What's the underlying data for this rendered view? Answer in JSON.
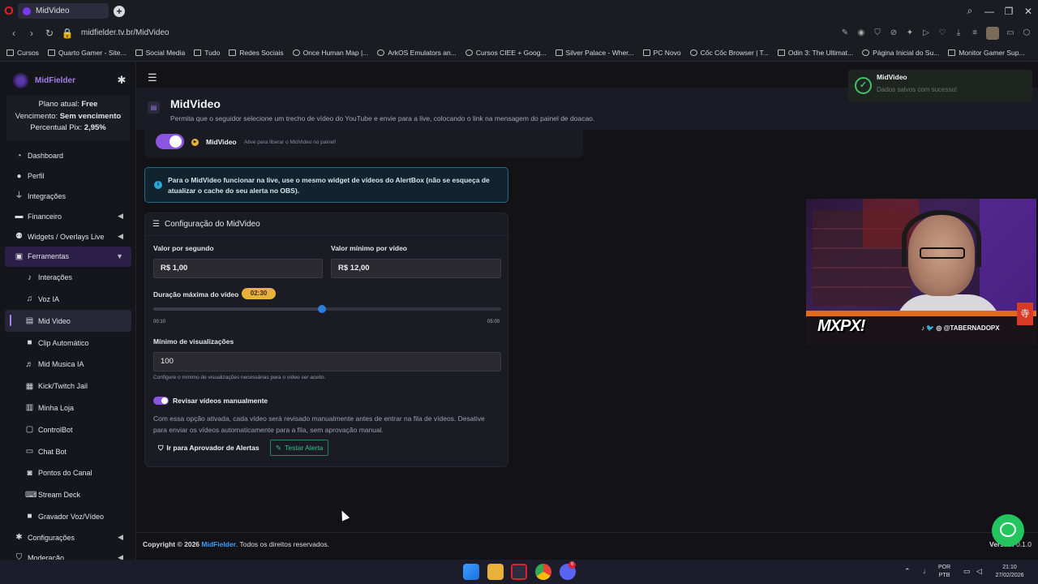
{
  "browser": {
    "tab_title": "MidVideo",
    "url": "midfielder.tv.br/MidVideo",
    "bookmarks": [
      "Cursos",
      "Quarto Gamer - Site...",
      "Social Media",
      "Tudo",
      "Redes Sociais",
      "Once Human Map |...",
      "ArkOS Emulators an...",
      "Cursos CIEE + Goog...",
      "Silver Palace - Wher...",
      "PC Novo",
      "Cốc Cốc Browser | T...",
      "Odin 3: The Ultimat...",
      "Página Inicial do Su...",
      "Monitor Gamer Sup..."
    ]
  },
  "sidebar": {
    "brand": "MidFielder",
    "plan_label": "Plano atual:",
    "plan_value": "Free",
    "expiry_label": "Vencimento:",
    "expiry_value": "Sem vencimento",
    "pix_label": "Percentual Pix:",
    "pix_value": "2,95%",
    "items": [
      {
        "label": "Dashboard",
        "icon": "speedometer-icon"
      },
      {
        "label": "Perfil",
        "icon": "user-icon"
      },
      {
        "label": "Integrações",
        "icon": "plug-icon"
      },
      {
        "label": "Financeiro",
        "icon": "wallet-icon"
      },
      {
        "label": "Widgets / Overlays Live",
        "icon": "users-icon"
      },
      {
        "label": "Ferramentas",
        "icon": "toolbox-icon"
      }
    ],
    "sub_items": [
      {
        "label": "Interações",
        "icon": "bell-icon"
      },
      {
        "label": "Voz IA",
        "icon": "mic-icon"
      },
      {
        "label": "Mid Video",
        "icon": "film-icon"
      },
      {
        "label": "Clip Automático",
        "icon": "video-icon"
      },
      {
        "label": "Mid Musica IA",
        "icon": "music-icon"
      },
      {
        "label": "Kick/Twitch Jail",
        "icon": "jail-icon"
      },
      {
        "label": "Minha Loja",
        "icon": "store-icon"
      },
      {
        "label": "ControlBot",
        "icon": "robot-icon"
      },
      {
        "label": "Chat Bot",
        "icon": "chat-icon"
      },
      {
        "label": "Pontos do Canal",
        "icon": "coins-icon"
      },
      {
        "label": "Stream Deck",
        "icon": "keyboard-icon"
      },
      {
        "label": "Gravador Voz/Vídeo",
        "icon": "camera-icon"
      }
    ],
    "bottom_items": [
      {
        "label": "Configurações",
        "icon": "gear-icon"
      },
      {
        "label": "Moderação",
        "icon": "shield-icon"
      }
    ]
  },
  "page": {
    "title": "MidVideo",
    "description": "Permita que o seguidor selecione um trecho de vídeo do YouTube e envie para a live, colocando o link na mensagem do painel de doacao.",
    "toggle_label": "MidVideo",
    "toggle_hint": "Ative para liberar o MidVideo no painel!",
    "info_text": "Para o MidVideo funcionar na live, use o mesmo widget de vídeos do AlertBox (não se esqueça de atualizar o cache do seu alerta no OBS).",
    "config_title": "Configuração do MidVideo",
    "price_per_second_label": "Valor por segundo",
    "price_per_second_value": "R$ 1,00",
    "min_price_label": "Valor mínimo por vídeo",
    "min_price_value": "R$ 12,00",
    "max_duration_label": "Duração máxima do vídeo",
    "max_duration_value": "02:30",
    "slider_fraction": 0.484,
    "slider_min": "00:10",
    "slider_max": "05:00",
    "min_views_label": "Mínimo de visualizações",
    "min_views_value": "100",
    "min_views_help": "Configure o mínimo de visualizações necessárias para o vídeo ser aceito.",
    "manual_review_label": "Revisar vídeos manualmente",
    "manual_review_desc": "Com essa opção ativada, cada vídeo será revisado manualmente antes de entrar na fila de vídeos. Desative para enviar os vídeos automaticamente para a fila, sem aprovação manual.",
    "approver_button": "Ir para Aprovador de Alertas",
    "test_button": "Testar Alerta"
  },
  "toast": {
    "title": "MidVideo",
    "message": "Dados salvos com sucesso!"
  },
  "footer": {
    "copyright_prefix": "Copyright © 2026",
    "brand": "MidFielder",
    "suffix": ". Todos os direitos reservados.",
    "version_label": "Versão:",
    "version_value": "0.1.0"
  },
  "overlay": {
    "logo": "MXPX!",
    "social": "@TABERNADOPX",
    "seal": "寺"
  },
  "taskbar": {
    "lang": "POR",
    "layout": "PTB",
    "time": "21:10",
    "date": "27/02/2026",
    "discord_badge": "6"
  },
  "colors": {
    "accent": "#8a55e0",
    "success": "#36c08a",
    "info": "#28a8d8",
    "badge": "#e8b23a"
  }
}
